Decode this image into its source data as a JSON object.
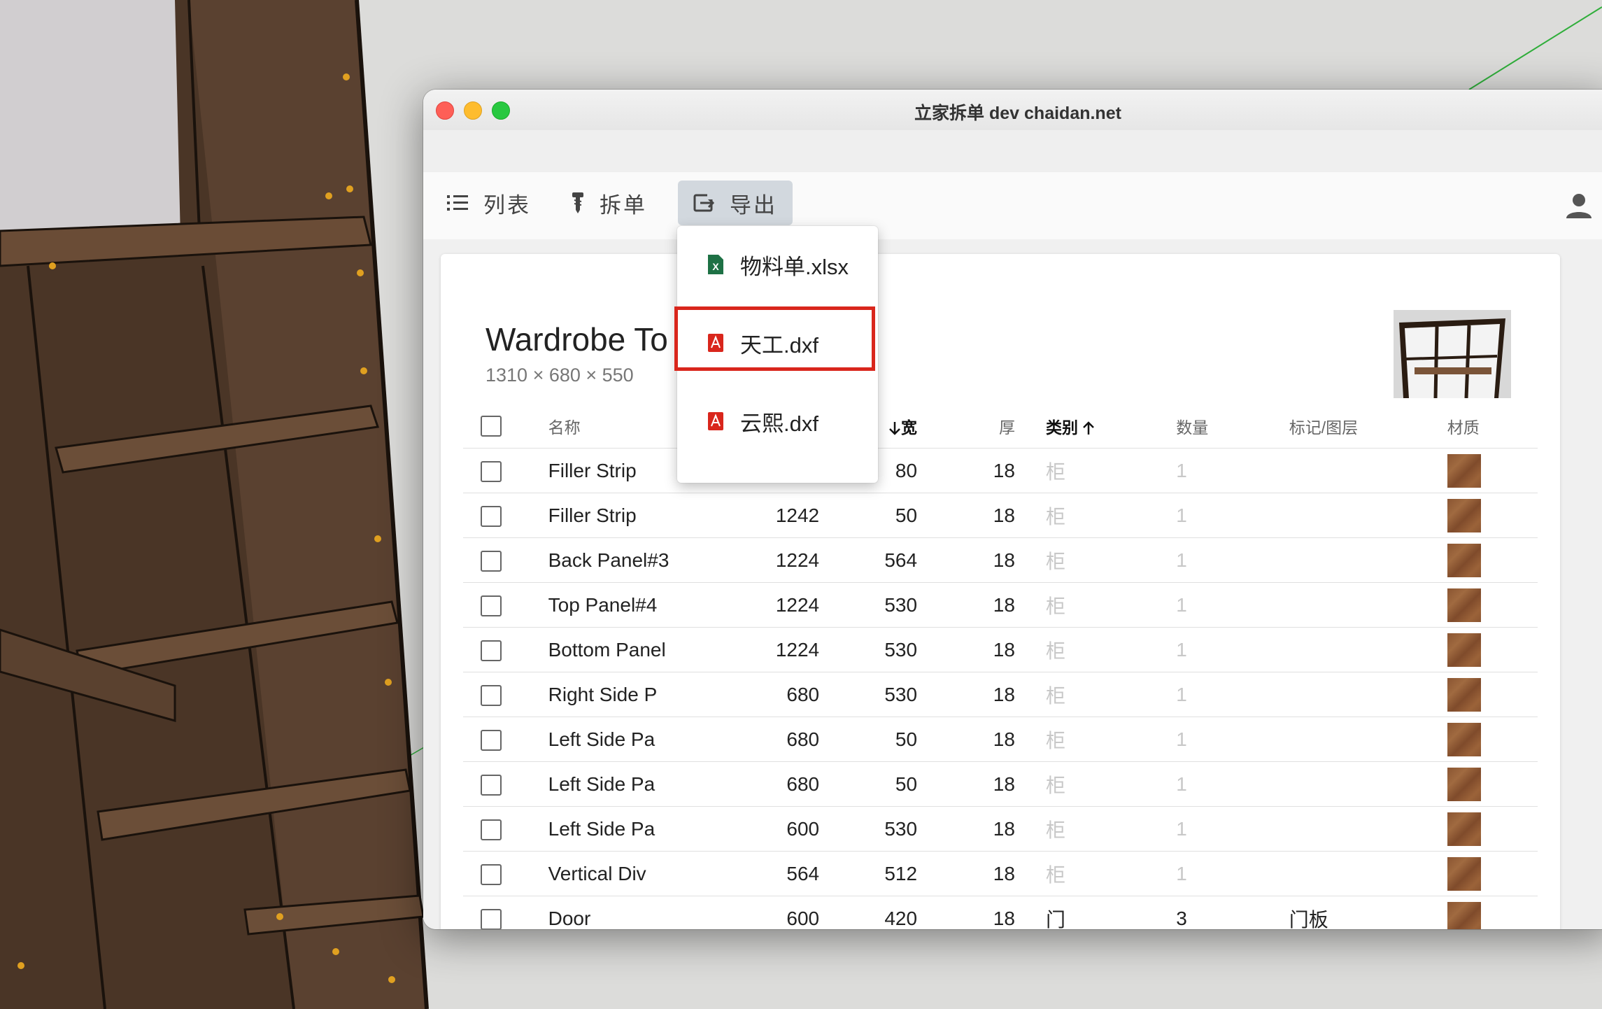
{
  "window": {
    "title": "立家拆单 dev  chaidan.net"
  },
  "toolbar": {
    "list_label": "列表",
    "split_label": "拆单",
    "export_label": "导出"
  },
  "export_menu": {
    "items": [
      {
        "label": "物料单.xlsx",
        "icon": "excel-file-icon",
        "color": "#1e7145"
      },
      {
        "label": "天工.dxf",
        "icon": "pdf-file-icon",
        "color": "#d9261c",
        "highlighted": true
      },
      {
        "label": "云熙.dxf",
        "icon": "pdf-file-icon",
        "color": "#d9261c"
      }
    ]
  },
  "project": {
    "title": "Wardrobe To",
    "dims": "1310 × 680 × 550"
  },
  "table": {
    "headers": {
      "name": "名称",
      "width": "宽",
      "thick": "厚",
      "category": "类别",
      "qty": "数量",
      "mark": "标记/图层",
      "material": "材质"
    },
    "rows": [
      {
        "name": "Filler Strip",
        "length": "",
        "width": "80",
        "thick": "18",
        "category": "柜",
        "qty": "1",
        "mark": ""
      },
      {
        "name": "Filler Strip",
        "length": "1242",
        "width": "50",
        "thick": "18",
        "category": "柜",
        "qty": "1",
        "mark": ""
      },
      {
        "name": "Back Panel#3",
        "length": "1224",
        "width": "564",
        "thick": "18",
        "category": "柜",
        "qty": "1",
        "mark": ""
      },
      {
        "name": "Top Panel#4",
        "length": "1224",
        "width": "530",
        "thick": "18",
        "category": "柜",
        "qty": "1",
        "mark": ""
      },
      {
        "name": "Bottom Panel",
        "length": "1224",
        "width": "530",
        "thick": "18",
        "category": "柜",
        "qty": "1",
        "mark": ""
      },
      {
        "name": "Right Side P",
        "length": "680",
        "width": "530",
        "thick": "18",
        "category": "柜",
        "qty": "1",
        "mark": ""
      },
      {
        "name": "Left Side Pa",
        "length": "680",
        "width": "50",
        "thick": "18",
        "category": "柜",
        "qty": "1",
        "mark": ""
      },
      {
        "name": "Left Side Pa",
        "length": "680",
        "width": "50",
        "thick": "18",
        "category": "柜",
        "qty": "1",
        "mark": ""
      },
      {
        "name": "Left Side Pa",
        "length": "600",
        "width": "530",
        "thick": "18",
        "category": "柜",
        "qty": "1",
        "mark": ""
      },
      {
        "name": "Vertical Div",
        "length": "564",
        "width": "512",
        "thick": "18",
        "category": "柜",
        "qty": "1",
        "mark": ""
      },
      {
        "name": "Door",
        "length": "600",
        "width": "420",
        "thick": "18",
        "category": "门",
        "qty": "3",
        "mark": "门板"
      }
    ]
  },
  "colors": {
    "accent_red": "#d9261c",
    "excel_green": "#1e7145",
    "export_active_bg": "#d2d8de",
    "material_wood": "#8a5532"
  }
}
